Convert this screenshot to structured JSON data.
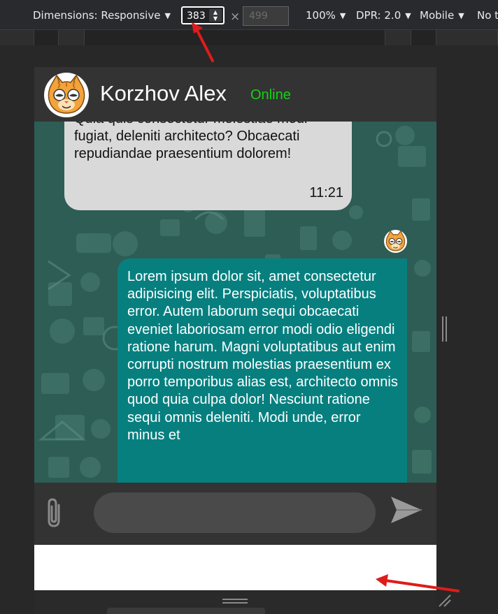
{
  "devtools": {
    "dimensions_label": "Dimensions: Responsive",
    "width_value": "383",
    "times": "×",
    "height_placeholder": "499",
    "zoom": "100%",
    "dpr": "DPR: 2.0",
    "device_mode": "Mobile",
    "throttle": "No t"
  },
  "chat": {
    "contact_name": "Korzhov Alex",
    "status": "Online",
    "incoming_message": {
      "text": "Quia quis consectetur molestiae modi fugiat, deleniti architecto? Obcaecati repudiandae praesentium dolorem!",
      "time": "11:21"
    },
    "outgoing_message": {
      "text": "Lorem ipsum dolor sit, amet consectetur adipisicing elit. Perspiciatis, voluptatibus error. Autem laborum sequi obcaecati eveniet laboriosam error modi odio eligendi ratione harum. Magni voluptatibus aut enim corrupti nostrum molestias praesentium ex porro temporibus alias est, architecto omnis quod quia culpa dolor! Nesciunt ratione sequi omnis deleniti. Modi unde, error minus et"
    },
    "composer": {
      "placeholder": ""
    }
  },
  "colors": {
    "online": "#14d214",
    "outgoing_bubble": "#077f7f",
    "incoming_bubble": "#d9d9d9",
    "annotation_arrow": "#e01b1b"
  },
  "icons": {
    "attach": "paperclip-icon",
    "send": "send-icon",
    "avatar": "cat-avatar"
  }
}
